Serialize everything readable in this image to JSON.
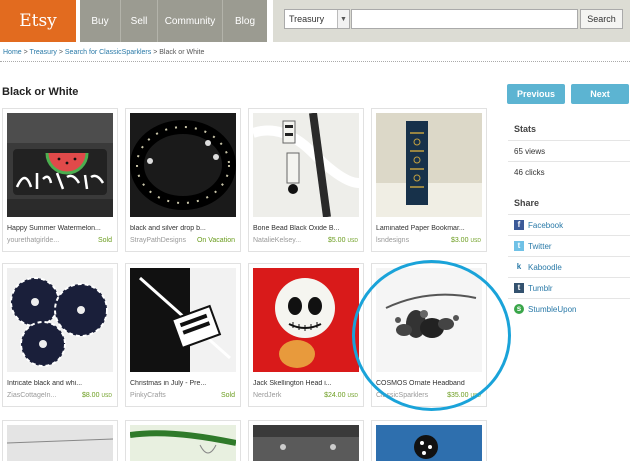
{
  "header": {
    "logo": "Etsy",
    "nav": [
      "Buy",
      "Sell",
      "Community",
      "Blog"
    ],
    "search_scope": "Treasury",
    "search_placeholder": "",
    "search_button": "Search"
  },
  "breadcrumb": {
    "home": "Home",
    "sep": " > ",
    "treasury": "Treasury",
    "search": "Search for ClassicSparklers",
    "current": "Black or White"
  },
  "page_title": "Black or White",
  "pager": {
    "previous": "Previous",
    "next": "Next"
  },
  "stats": {
    "heading": "Stats",
    "views": "65 views",
    "clicks": "46 clicks"
  },
  "share": {
    "heading": "Share",
    "links": [
      "Facebook",
      "Twitter",
      "Kaboodle",
      "Tumblr",
      "StumbleUpon"
    ]
  },
  "items": [
    {
      "title": "Happy Summer Watermelon...",
      "shop": "yourethatgirlde...",
      "status": "Sold"
    },
    {
      "title": "black and silver drop b...",
      "shop": "StrayPathDesigns",
      "status": "On Vacation"
    },
    {
      "title": "Bone Bead Black Oxide B...",
      "shop": "NatalieKelsey...",
      "price": "$5.00",
      "currency": "USD"
    },
    {
      "title": "Laminated Paper Bookmar...",
      "shop": "lsndesigns",
      "price": "$3.00",
      "currency": "USD"
    },
    {
      "title": "Intricate black and whi...",
      "shop": "ZiasCottageIn...",
      "price": "$8.00",
      "currency": "USD"
    },
    {
      "title": "Christmas in July - Pre...",
      "shop": "PinkyCrafts",
      "status": "Sold"
    },
    {
      "title": "Jack Skellington Head i...",
      "shop": "NerdJerk",
      "price": "$24.00",
      "currency": "USD"
    },
    {
      "title": "COSMOS Ornate Headband",
      "shop": "ClassicSparklers",
      "price": "$35.00",
      "currency": "USD"
    }
  ],
  "colors": {
    "brand": "#e26b1f",
    "accent_button": "#5cb4d2",
    "price_green": "#6a9c1d",
    "highlight_circle": "#1aa3d9"
  }
}
